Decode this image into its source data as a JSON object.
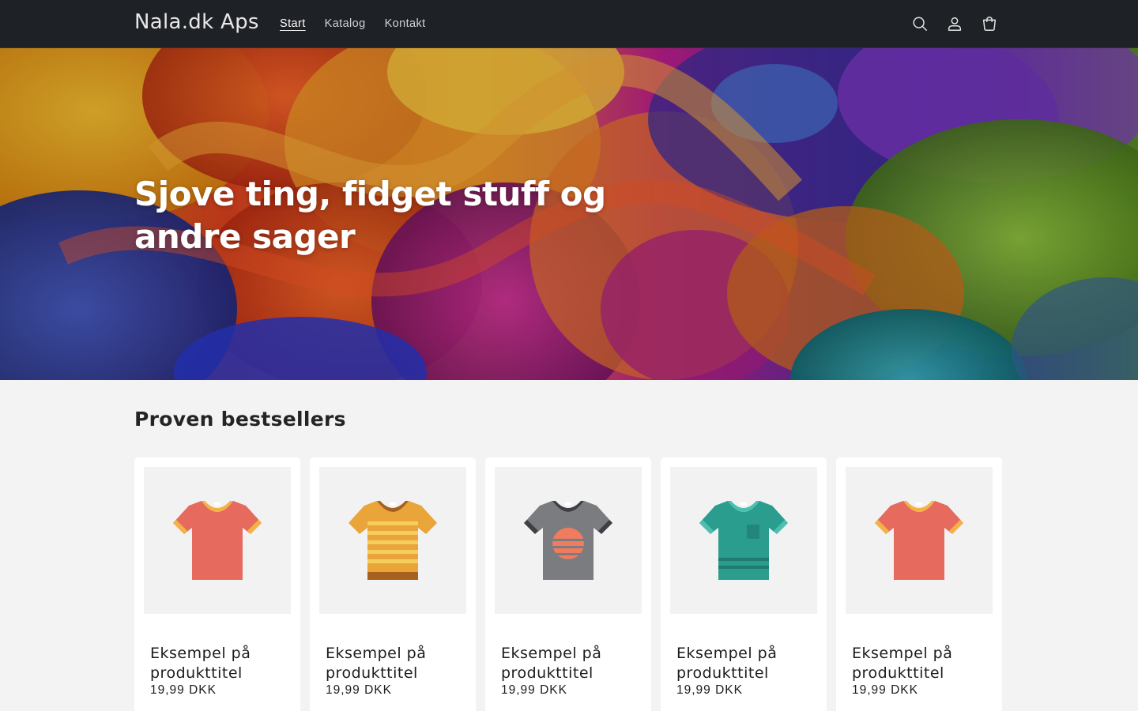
{
  "header": {
    "logo": "Nala.dk Aps",
    "nav": [
      {
        "label": "Start",
        "active": true
      },
      {
        "label": "Katalog",
        "active": false
      },
      {
        "label": "Kontakt",
        "active": false
      }
    ],
    "icons": [
      "search-icon",
      "account-icon",
      "cart-icon"
    ]
  },
  "hero": {
    "title": "Sjove ting, fidget stuff og andre sager"
  },
  "bestsellers": {
    "title": "Proven bestsellers",
    "products": [
      {
        "title": "Eksempel på produkttitel",
        "price": "19,99 DKK",
        "tshirt_color": "#e66a5e",
        "accent": "#f4b244",
        "style": "plain"
      },
      {
        "title": "Eksempel på produkttitel",
        "price": "19,99 DKK",
        "tshirt_color": "#e9a43a",
        "accent": "#f7cd5e",
        "style": "striped"
      },
      {
        "title": "Eksempel på produkttitel",
        "price": "19,99 DKK",
        "tshirt_color": "#7a7c80",
        "accent": "#ef7c5e",
        "style": "sunset"
      },
      {
        "title": "Eksempel på produkttitel",
        "price": "19,99 DKK",
        "tshirt_color": "#2a9d8f",
        "accent": "#4cc0b0",
        "style": "pocket"
      },
      {
        "title": "Eksempel på produkttitel",
        "price": "19,99 DKK",
        "tshirt_color": "#e66a5e",
        "accent": "#f4b244",
        "style": "plain"
      }
    ]
  }
}
